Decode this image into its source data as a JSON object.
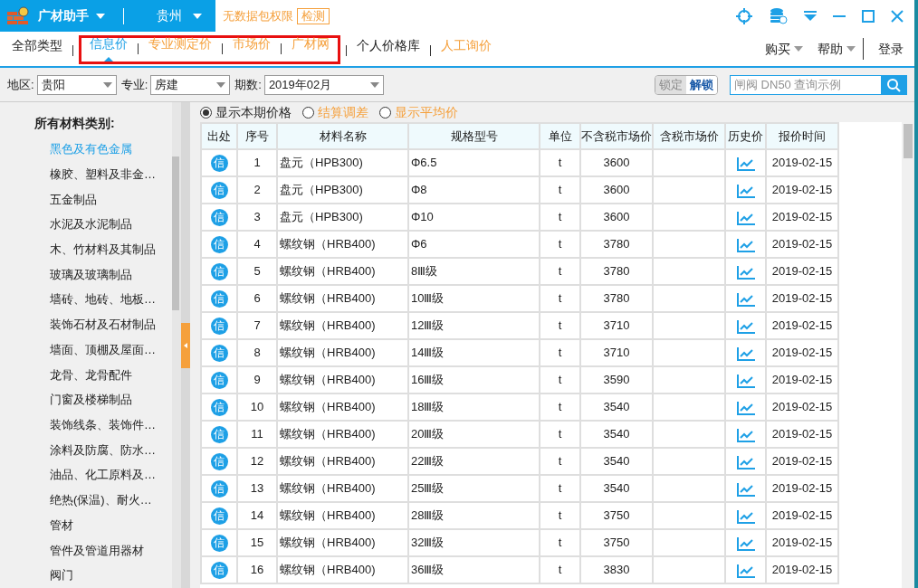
{
  "title_bar": {
    "app_menu": "广材助手",
    "region_menu": "贵州",
    "notice": "无数据包权限",
    "check_button": "检测"
  },
  "nav": {
    "tabs": [
      {
        "label": "全部类型",
        "selected": false,
        "color": "#222222",
        "highlighted": false
      },
      {
        "label": "信息价",
        "selected": true,
        "color": "#1ea0e6",
        "highlighted": true
      },
      {
        "label": "专业测定价",
        "selected": false,
        "color": "#f5a03c",
        "highlighted": true
      },
      {
        "label": "市场价",
        "selected": false,
        "color": "#f5a03c",
        "highlighted": true
      },
      {
        "label": "广材网",
        "selected": false,
        "color": "#f5a03c",
        "highlighted": true
      },
      {
        "label": "个人价格库",
        "selected": false,
        "color": "#222222",
        "highlighted": false
      },
      {
        "label": "人工询价",
        "selected": false,
        "color": "#f5a03c",
        "highlighted": false
      }
    ],
    "right": [
      {
        "label": "购买",
        "dropdown": true
      },
      {
        "label": "帮助",
        "dropdown": true
      },
      {
        "label": "登录",
        "dropdown": false
      }
    ]
  },
  "filters": [
    {
      "label": "地区:",
      "value": "贵阳"
    },
    {
      "label": "专业:",
      "value": "房建"
    },
    {
      "label": "期数:",
      "value": "2019年02月"
    }
  ],
  "lock": {
    "lock_label": "锁定",
    "unlock_label": "解锁",
    "locked": false
  },
  "search": {
    "placeholder": "闸阀 DN50 查询示例"
  },
  "sidebar": {
    "title": "所有材料类别:",
    "items": [
      {
        "label": "黑色及有色金属",
        "selected": true
      },
      {
        "label": "橡胶、塑料及非金…",
        "selected": false
      },
      {
        "label": "五金制品",
        "selected": false
      },
      {
        "label": "水泥及水泥制品",
        "selected": false
      },
      {
        "label": "木、竹材料及其制品",
        "selected": false
      },
      {
        "label": "玻璃及玻璃制品",
        "selected": false
      },
      {
        "label": "墙砖、地砖、地板…",
        "selected": false
      },
      {
        "label": "装饰石材及石材制品",
        "selected": false
      },
      {
        "label": "墙面、顶棚及屋面…",
        "selected": false
      },
      {
        "label": "龙骨、龙骨配件",
        "selected": false
      },
      {
        "label": "门窗及楼梯制品",
        "selected": false
      },
      {
        "label": "装饰线条、装饰件…",
        "selected": false
      },
      {
        "label": "涂料及防腐、防水…",
        "selected": false
      },
      {
        "label": "油品、化工原料及…",
        "selected": false
      },
      {
        "label": "绝热(保温)、耐火…",
        "selected": false
      },
      {
        "label": "管材",
        "selected": false
      },
      {
        "label": "管件及管道用器材",
        "selected": false
      },
      {
        "label": "阀门",
        "selected": false
      }
    ]
  },
  "price_options": [
    {
      "label": "显示本期价格",
      "selected": true,
      "color": "#222222"
    },
    {
      "label": "结算调差",
      "selected": false,
      "color": "#f5a03c"
    },
    {
      "label": "显示平均价",
      "selected": false,
      "color": "#f5a03c"
    }
  ],
  "table": {
    "columns": [
      "出处",
      "序号",
      "材料名称",
      "规格型号",
      "单位",
      "不含税市场价",
      "含税市场价",
      "历史价",
      "报价时间"
    ],
    "rows": [
      {
        "source": "信",
        "no": "1",
        "name": "盘元（HPB300)",
        "spec": "Φ6.5",
        "unit": "t",
        "price": "3600",
        "time": "2019-02-15"
      },
      {
        "source": "信",
        "no": "2",
        "name": "盘元（HPB300)",
        "spec": "Φ8",
        "unit": "t",
        "price": "3600",
        "time": "2019-02-15"
      },
      {
        "source": "信",
        "no": "3",
        "name": "盘元（HPB300)",
        "spec": "Φ10",
        "unit": "t",
        "price": "3600",
        "time": "2019-02-15"
      },
      {
        "source": "信",
        "no": "4",
        "name": "螺纹钢（HRB400)",
        "spec": "Φ6",
        "unit": "t",
        "price": "3780",
        "time": "2019-02-15"
      },
      {
        "source": "信",
        "no": "5",
        "name": "螺纹钢（HRB400)",
        "spec": "8Ⅲ级",
        "unit": "t",
        "price": "3780",
        "time": "2019-02-15"
      },
      {
        "source": "信",
        "no": "6",
        "name": "螺纹钢（HRB400)",
        "spec": "10Ⅲ级",
        "unit": "t",
        "price": "3780",
        "time": "2019-02-15"
      },
      {
        "source": "信",
        "no": "7",
        "name": "螺纹钢（HRB400)",
        "spec": "12Ⅲ级",
        "unit": "t",
        "price": "3710",
        "time": "2019-02-15"
      },
      {
        "source": "信",
        "no": "8",
        "name": "螺纹钢（HRB400)",
        "spec": "14Ⅲ级",
        "unit": "t",
        "price": "3710",
        "time": "2019-02-15"
      },
      {
        "source": "信",
        "no": "9",
        "name": "螺纹钢（HRB400)",
        "spec": "16Ⅲ级",
        "unit": "t",
        "price": "3590",
        "time": "2019-02-15"
      },
      {
        "source": "信",
        "no": "10",
        "name": "螺纹钢（HRB400)",
        "spec": "18Ⅲ级",
        "unit": "t",
        "price": "3540",
        "time": "2019-02-15"
      },
      {
        "source": "信",
        "no": "11",
        "name": "螺纹钢（HRB400)",
        "spec": "20Ⅲ级",
        "unit": "t",
        "price": "3540",
        "time": "2019-02-15"
      },
      {
        "source": "信",
        "no": "12",
        "name": "螺纹钢（HRB400)",
        "spec": "22Ⅲ级",
        "unit": "t",
        "price": "3540",
        "time": "2019-02-15"
      },
      {
        "source": "信",
        "no": "13",
        "name": "螺纹钢（HRB400)",
        "spec": "25Ⅲ级",
        "unit": "t",
        "price": "3540",
        "time": "2019-02-15"
      },
      {
        "source": "信",
        "no": "14",
        "name": "螺纹钢（HRB400)",
        "spec": "28Ⅲ级",
        "unit": "t",
        "price": "3750",
        "time": "2019-02-15"
      },
      {
        "source": "信",
        "no": "15",
        "name": "螺纹钢（HRB400)",
        "spec": "32Ⅲ级",
        "unit": "t",
        "price": "3750",
        "time": "2019-02-15"
      },
      {
        "source": "信",
        "no": "16",
        "name": "螺纹钢（HRB400)",
        "spec": "36Ⅲ级",
        "unit": "t",
        "price": "3830",
        "time": "2019-02-15"
      }
    ]
  }
}
